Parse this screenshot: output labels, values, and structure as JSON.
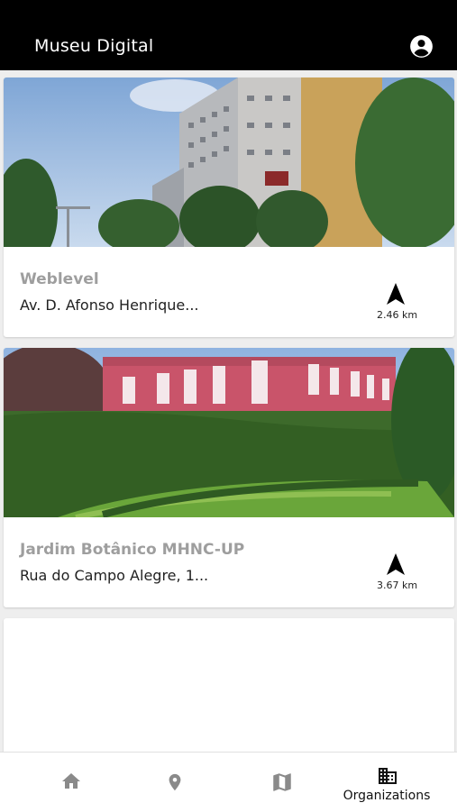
{
  "app": {
    "title": "Museu Digital"
  },
  "cards": [
    {
      "name": "Weblevel",
      "address": "Av. D. Afonso Henrique...",
      "distance": "2.46 km"
    },
    {
      "name": "Jardim Botânico MHNC-UP",
      "address": "Rua do Campo Alegre, 1...",
      "distance": "3.67 km"
    }
  ],
  "bottom_nav": {
    "active_label": "Organizations",
    "items": [
      "home-icon",
      "location-pin-icon",
      "map-icon",
      "organizations-icon"
    ]
  },
  "colors": {
    "appbar": "#000000",
    "background": "#eeeeee",
    "card": "#ffffff",
    "muted_text": "#9e9e9e"
  }
}
